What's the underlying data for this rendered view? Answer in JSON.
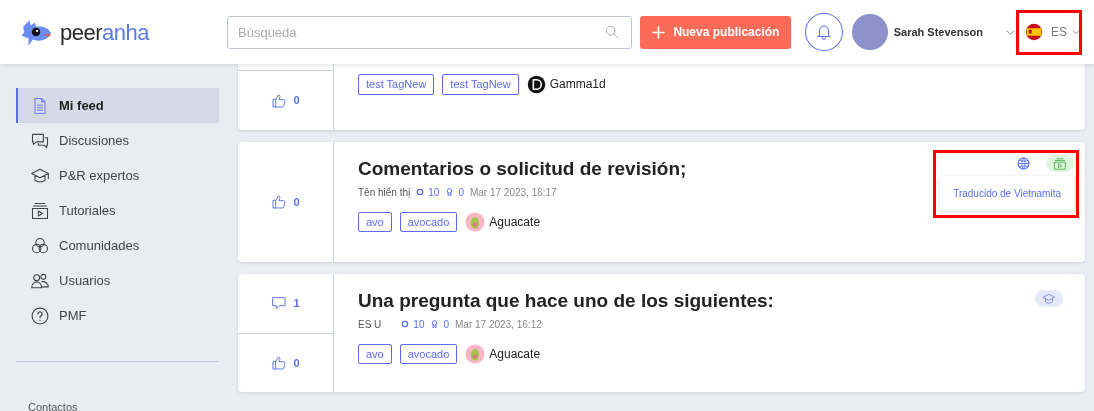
{
  "header": {
    "logo": {
      "dark": "peer",
      "accent": "anha"
    },
    "search": {
      "placeholder": "Búsqueda"
    },
    "new_post_button": {
      "label": "Nueva publicación"
    },
    "user": {
      "name": "Sarah Stevenson"
    },
    "language": {
      "code": "ES",
      "highlighted": true
    }
  },
  "sidebar": {
    "items": [
      {
        "label": "Mi feed",
        "selected": true
      },
      {
        "label": "Discusiones",
        "selected": false
      },
      {
        "label": "P&R expertos",
        "selected": false
      },
      {
        "label": "Tutoriales",
        "selected": false
      },
      {
        "label": "Comunidades",
        "selected": false
      },
      {
        "label": "Usuarios",
        "selected": false
      },
      {
        "label": "PMF",
        "selected": false
      }
    ],
    "section_heading": "Contactos"
  },
  "feed": [
    {
      "kind": "clipped",
      "votes": "0",
      "tags": [
        "test TagNew",
        "test TagNew"
      ],
      "community": {
        "name": "Gamma1d",
        "kind": "dark"
      }
    },
    {
      "kind": "tutorial",
      "title": "Comentarios o solicitud de revisión;",
      "author": "Tên hiển thị",
      "rating": "10",
      "achievements": "0",
      "date": "Mar 17 2023, 16:17",
      "votes": "0",
      "tags": [
        "avo",
        "avocado"
      ],
      "community": {
        "name": "Aguacate",
        "kind": "avocado"
      },
      "translation": {
        "note": "Traducido de Vietnamita",
        "highlighted": true
      }
    },
    {
      "kind": "question",
      "answers": "1",
      "title": "Una pregunta que hace uno de los siguientes:",
      "author": "ES U",
      "rating": "10",
      "achievements": "0",
      "date": "Mar 17 2023, 16:12",
      "votes": "0",
      "tags": [
        "avo",
        "avocado"
      ],
      "community": {
        "name": "Aguacate",
        "kind": "avocado"
      }
    }
  ]
}
